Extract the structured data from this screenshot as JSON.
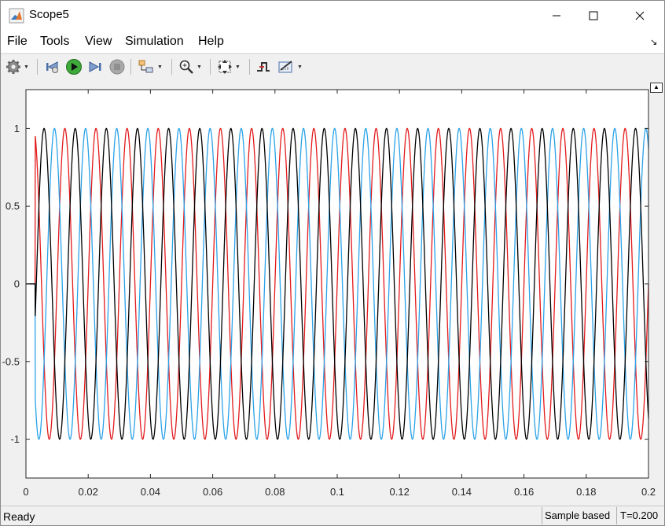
{
  "window": {
    "title": "Scope5",
    "app_icon": "matlab-icon"
  },
  "menubar": {
    "items": [
      "File",
      "Tools",
      "View",
      "Simulation",
      "Help"
    ]
  },
  "toolbar": {
    "icons": [
      "settings-gear-icon",
      "step-back-icon",
      "run-icon",
      "step-forward-icon",
      "stop-icon",
      "highlight-block-icon",
      "zoom-in-icon",
      "fit-axes-icon",
      "triggers-icon",
      "measurements-icon"
    ]
  },
  "status": {
    "ready": "Ready",
    "mode": "Sample based",
    "time": "T=0.200"
  },
  "chart_data": {
    "type": "line",
    "xlim": [
      0,
      0.2
    ],
    "ylim": [
      -1.25,
      1.25
    ],
    "x_ticks": [
      "0",
      "0.02",
      "0.04",
      "0.06",
      "0.08",
      "0.1",
      "0.12",
      "0.14",
      "0.16",
      "0.18",
      "0.2"
    ],
    "y_ticks": [
      "1",
      "0.5",
      "0",
      "-0.5",
      "-1"
    ],
    "grid": false,
    "series": [
      {
        "color": "#e31a1c",
        "function": "sin",
        "frequency_hz": 100,
        "phase_deg": 0,
        "start_time": 0.003,
        "initial_value": 0
      },
      {
        "color": "#2aa2e8",
        "function": "sin",
        "frequency_hz": 100,
        "phase_deg": 120,
        "start_time": 0.003,
        "initial_value": 0
      },
      {
        "color": "#000000",
        "function": "sin",
        "frequency_hz": 100,
        "phase_deg": -120,
        "start_time": 0.003,
        "initial_value": 0
      }
    ]
  }
}
